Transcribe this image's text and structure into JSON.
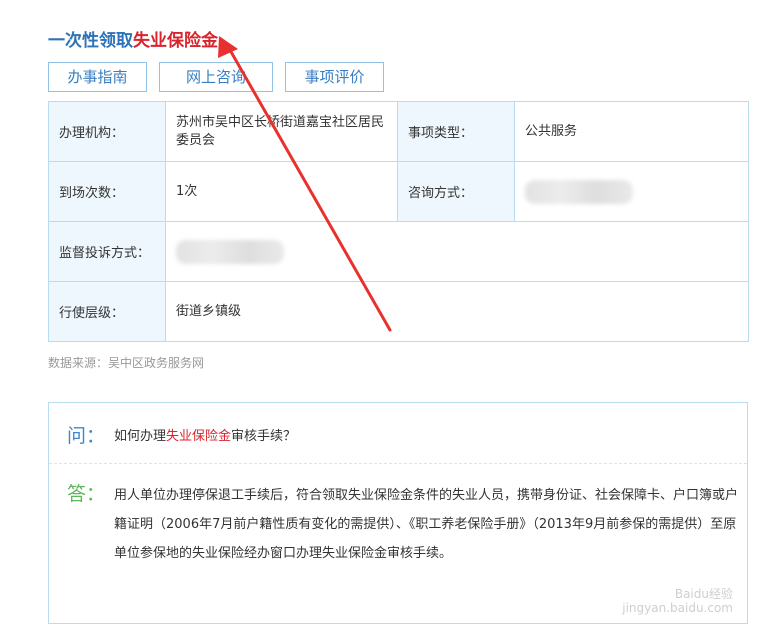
{
  "title": {
    "part1": "一次性领取",
    "part2": "失业保险金"
  },
  "tabs": [
    "办事指南",
    "网上咨询",
    "事项评价"
  ],
  "info": {
    "rows": [
      {
        "label1": "办理机构：",
        "value1": "苏州市吴中区长桥街道嘉宝社区居民委员会",
        "label2": "事项类型：",
        "value2": "公共服务"
      },
      {
        "label1": "到场次数：",
        "value1": "1次",
        "label2": "咨询方式："
      },
      {
        "label1": "监督投诉方式："
      },
      {
        "label1": "行使层级：",
        "value1": "街道乡镇级"
      }
    ]
  },
  "source": "数据来源：吴中区政务服务网",
  "qa": {
    "q_mark": "问：",
    "q_prefix": "如何办理",
    "q_highlight": "失业保险金",
    "q_suffix": "审核手续？",
    "a_mark": "答：",
    "answer": "用人单位办理停保退工手续后，符合领取失业保险金条件的失业人员，携带身份证、社会保障卡、户口簿或户籍证明（2006年7月前户籍性质有变化的需提供）、《职工养老保险手册》（2013年9月前参保的需提供）至原单位参保地的失业保险经办窗口办理失业保险金审核手续。"
  },
  "watermark": {
    "line1": "Baidu经验",
    "line2": "jingyan.baidu.com"
  },
  "colors": {
    "accent": "#2e72b8",
    "highlight": "#d9232d",
    "border": "#b9dcf0",
    "label_bg": "#eef7fd",
    "answer_mark": "#5db85b"
  }
}
